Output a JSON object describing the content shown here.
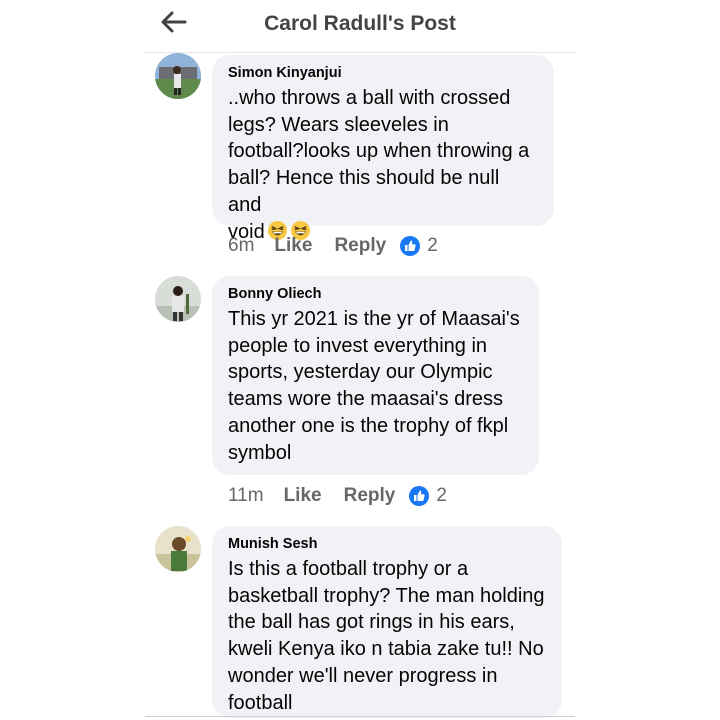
{
  "header": {
    "title": "Carol Radull's Post",
    "back_icon": "arrow-left-icon"
  },
  "comments": [
    {
      "author": "Simon Kinyanjui",
      "text": "..who throws a ball with crossed\nlegs? Wears sleeveles in\nfootball?looks up when throwing a\nball? Hence this should be null and\nvoid",
      "emoji": "grinning-squinting-face-emoji",
      "time": "6m",
      "like_label": "Like",
      "reply_label": "Reply",
      "reactions": "2"
    },
    {
      "author": "Bonny Oliech",
      "text": "This yr 2021 is the yr of Maasai's\npeople to invest everything in\nsports, yesterday our Olympic\nteams wore the maasai's dress\nanother one is the trophy of fkpl\nsymbol",
      "time": "11m",
      "like_label": "Like",
      "reply_label": "Reply",
      "reactions": "2"
    },
    {
      "author": "Munish Sesh",
      "text": "Is this a football trophy or a\nbasketball trophy? The man holding\nthe ball has got rings in his ears,\nkweli Kenya iko n tabia zake tu!! No\nwonder we'll never progress in\nfootball"
    }
  ],
  "colors": {
    "bubble": "#f0f2f5",
    "meta": "#65676b",
    "like_blue": "#1877f2"
  }
}
